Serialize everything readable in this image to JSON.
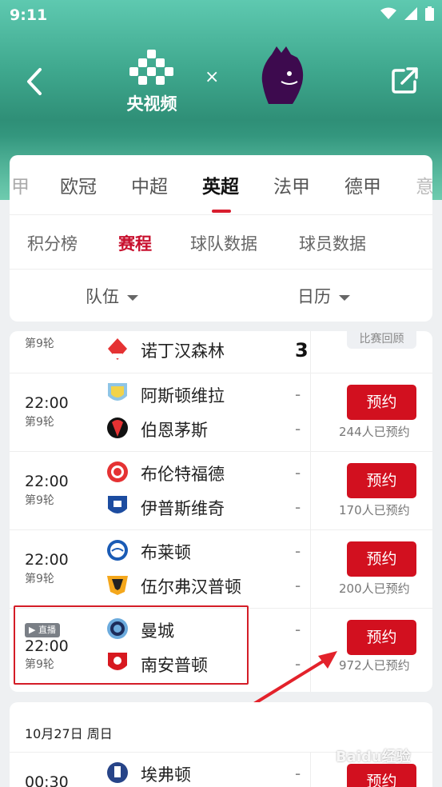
{
  "status": {
    "time": "9:11"
  },
  "header": {
    "left_brand": "央视频",
    "times": "×"
  },
  "tabs": [
    {
      "label": "甲"
    },
    {
      "label": "欧冠"
    },
    {
      "label": "中超"
    },
    {
      "label": "英超"
    },
    {
      "label": "法甲"
    },
    {
      "label": "德甲"
    },
    {
      "label": "意"
    }
  ],
  "subtabs": [
    {
      "label": "积分榜"
    },
    {
      "label": "赛程"
    },
    {
      "label": "球队数据"
    },
    {
      "label": "球员数据"
    }
  ],
  "filters": {
    "team": "队伍",
    "calendar": "日历"
  },
  "matches": [
    {
      "time": "",
      "round": "第9轮",
      "home": "",
      "away": "诺丁汉森林",
      "home_score": "",
      "away_score": "3",
      "action": "比赛回顾",
      "count": ""
    },
    {
      "time": "22:00",
      "round": "第9轮",
      "home": "阿斯顿维拉",
      "away": "伯恩茅斯",
      "home_score": "-",
      "away_score": "-",
      "action": "预约",
      "count": "244人已预约"
    },
    {
      "time": "22:00",
      "round": "第9轮",
      "home": "布伦特福德",
      "away": "伊普斯维奇",
      "home_score": "-",
      "away_score": "-",
      "action": "预约",
      "count": "170人已预约"
    },
    {
      "time": "22:00",
      "round": "第9轮",
      "home": "布莱顿",
      "away": "伍尔弗汉普顿",
      "home_score": "-",
      "away_score": "-",
      "action": "预约",
      "count": "200人已预约"
    },
    {
      "time": "22:00",
      "round": "第9轮",
      "live": "▶ 直播",
      "home": "曼城",
      "away": "南安普顿",
      "home_score": "-",
      "away_score": "-",
      "action": "预约",
      "count": "972人已预约"
    }
  ],
  "next_day": {
    "date": "10月27日 周日",
    "time": "00:30",
    "home": "埃弗顿",
    "home_score": "-",
    "action": "预约"
  },
  "watermark": "Baidu经验",
  "colors": {
    "accent": "#d2101f",
    "hero": "#3fa88e"
  }
}
